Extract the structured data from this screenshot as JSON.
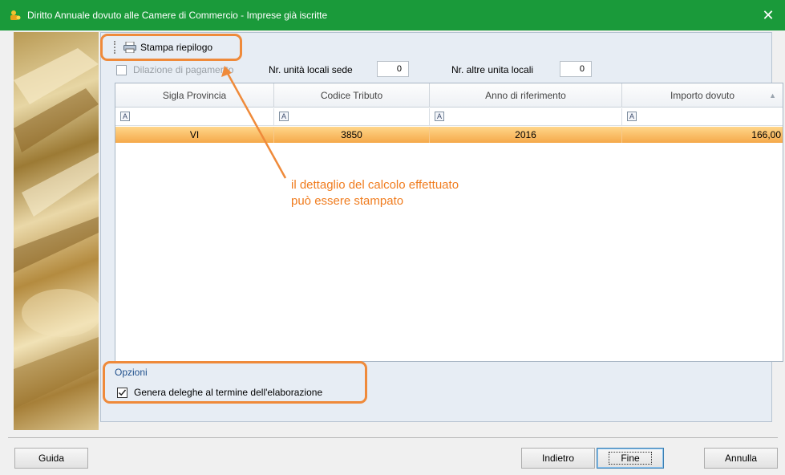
{
  "window": {
    "title": "Diritto Annuale dovuto alle Camere di Commercio - Imprese già iscritte",
    "close_label": "✕"
  },
  "toolbar": {
    "print_label": "Stampa riepilogo",
    "print_icon": "printer-icon"
  },
  "fields": {
    "dilazione_label": "Dilazione di pagamento",
    "dilazione_checked": false,
    "unita_sede_label": "Nr. unità locali sede",
    "unita_sede_value": "0",
    "altre_unita_label": "Nr. altre unita locali",
    "altre_unita_value": "0"
  },
  "grid": {
    "columns": [
      "Sigla Provincia",
      "Codice Tributo",
      "Anno di riferimento",
      "Importo dovuto"
    ],
    "filter_icon": "filter-text-icon",
    "rows": [
      [
        "VI",
        "3850",
        "2016",
        "166,00"
      ]
    ]
  },
  "options": {
    "title": "Opzioni",
    "genera_label": "Genera deleghe al termine dell'elaborazione",
    "genera_checked": true
  },
  "annotation": {
    "line1": "il dettaglio del calcolo effettuato",
    "line2": "può essere stampato",
    "color": "#f07c1e"
  },
  "buttons": {
    "guida": "Guida",
    "indietro": "Indietro",
    "fine": "Fine",
    "annulla": "Annulla"
  },
  "colors": {
    "titlebar": "#1a9a3a",
    "selected_row": "#f5a94a",
    "highlight": "#ef8a3a"
  }
}
